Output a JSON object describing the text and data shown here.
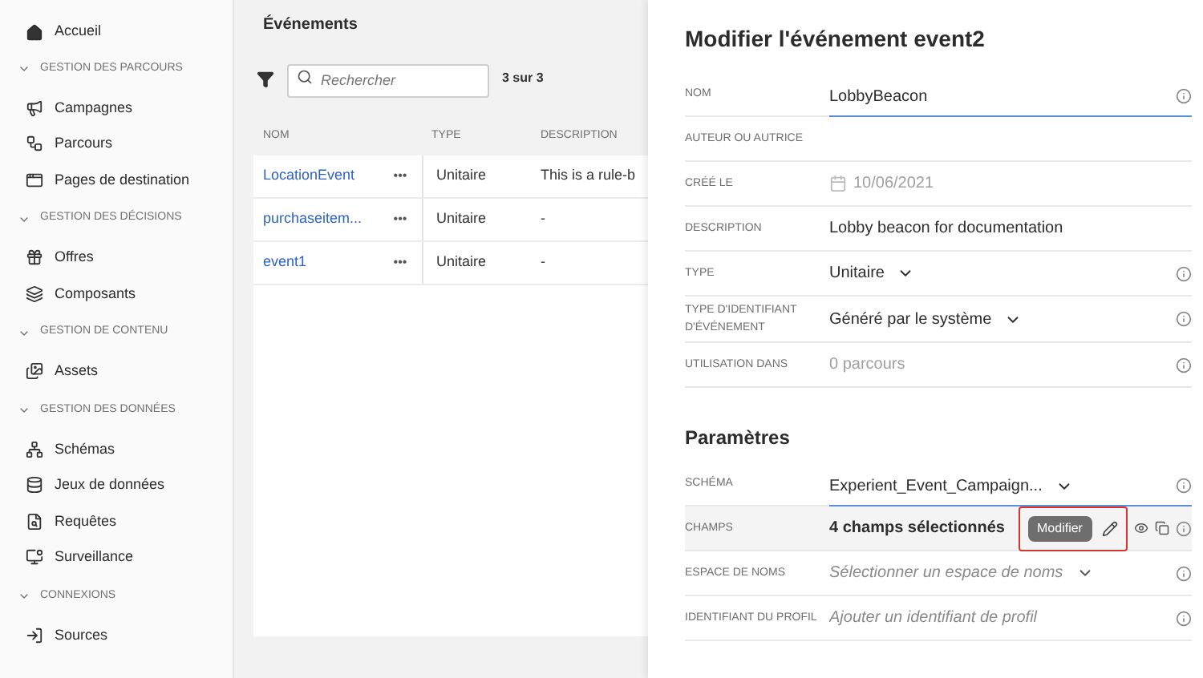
{
  "sidebar": {
    "home": {
      "label": "Accueil"
    },
    "sections": [
      {
        "title": "GESTION DES PARCOURS",
        "expanded": true,
        "items": [
          {
            "label": "Campagnes"
          },
          {
            "label": "Parcours"
          },
          {
            "label": "Pages de destination"
          }
        ]
      },
      {
        "title": "GESTION DES DÉCISIONS",
        "expanded": true,
        "items": [
          {
            "label": "Offres"
          },
          {
            "label": "Composants"
          }
        ]
      },
      {
        "title": "GESTION DE CONTENU",
        "expanded": true,
        "items": [
          {
            "label": "Assets"
          }
        ]
      },
      {
        "title": "GESTION DES DONNÉES",
        "expanded": true,
        "items": [
          {
            "label": "Schémas"
          },
          {
            "label": "Jeux de données"
          },
          {
            "label": "Requêtes"
          },
          {
            "label": "Surveillance"
          }
        ]
      },
      {
        "title": "CONNEXIONS",
        "expanded": true,
        "items": [
          {
            "label": "Sources"
          }
        ]
      }
    ]
  },
  "events_panel": {
    "title": "Événements",
    "search": {
      "placeholder": "Rechercher"
    },
    "count": "3 sur 3",
    "columns": [
      "NOM",
      "TYPE",
      "DESCRIPTION"
    ],
    "rows": [
      {
        "name": "LocationEvent",
        "more": "•••",
        "type": "Unitaire",
        "description": "This is a rule-b"
      },
      {
        "name": "purchaseitem...",
        "more": "•••",
        "type": "Unitaire",
        "description": "-"
      },
      {
        "name": "event1",
        "more": "•••",
        "type": "Unitaire",
        "description": "-"
      }
    ]
  },
  "edit_panel": {
    "title": "Modifier l'événement event2",
    "fields": [
      {
        "label": "NOM",
        "kind": "text",
        "value": "LobbyBeacon",
        "info": true,
        "underlined": true
      },
      {
        "label": "AUTEUR OU AUTRICE",
        "kind": "empty",
        "info": false,
        "underlined": false
      },
      {
        "label": "CRÉÉ LE",
        "kind": "date",
        "value": "10/06/2021",
        "info": false,
        "underlined": false
      },
      {
        "label": "DESCRIPTION",
        "kind": "text",
        "value": "Lobby beacon for documentation",
        "info": false,
        "underlined": false
      },
      {
        "label": "TYPE",
        "kind": "select",
        "value": "Unitaire",
        "info": true,
        "underlined": false
      },
      {
        "label": "TYPE D'IDENTIFIANT D'ÉVÉNEMENT",
        "kind": "select",
        "value": "Généré par le système",
        "info": true,
        "underlined": false
      },
      {
        "label": "UTILISATION DANS",
        "kind": "muted",
        "value": "0 parcours",
        "info": true,
        "underlined": false
      }
    ],
    "params_title": "Paramètres",
    "params": [
      {
        "label": "SCHÉMA",
        "kind": "select",
        "value": "Experient_Event_Campaign...",
        "info": true,
        "underlined": true
      },
      {
        "label": "CHAMPS",
        "kind": "fields",
        "value": "4 champs sélectionnés",
        "tooltip": "Modifier",
        "info": true,
        "underlined": false
      },
      {
        "label": "ESPACE DE NOMS",
        "kind": "placeholder-select",
        "placeholder": "Sélectionner un espace de noms",
        "info": true,
        "underlined": false
      },
      {
        "label": "IDENTIFIANT DU PROFIL",
        "kind": "placeholder",
        "placeholder": "Ajouter un identifiant de profil",
        "info": true,
        "underlined": false
      }
    ]
  }
}
